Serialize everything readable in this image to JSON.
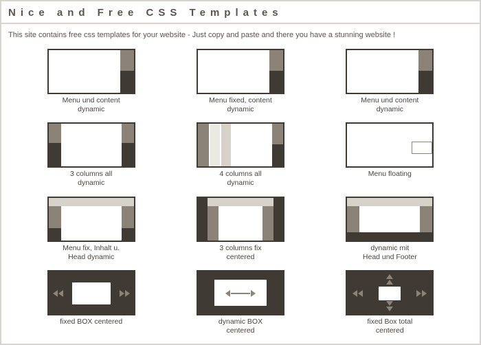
{
  "header": {
    "title": "Nice and Free CSS Templates",
    "subtitle": "This site contains free css templates for your website - Just copy and paste and there you have a stunning website !"
  },
  "templates": [
    {
      "caption": "Menu und content\ndynamic"
    },
    {
      "caption": "Menu fixed, content\ndynamic"
    },
    {
      "caption": "Menu und content\ndynamic"
    },
    {
      "caption": "3 columns all\ndynamic"
    },
    {
      "caption": "4 columns all\ndynamic"
    },
    {
      "caption": "Menu floating"
    },
    {
      "caption": "Menu fix, Inhalt u.\nHead dynamic"
    },
    {
      "caption": "3 columns fix\ncentered"
    },
    {
      "caption": "dynamic mit\nHead und Footer"
    },
    {
      "caption": "fixed BOX centered"
    },
    {
      "caption": "dynamic BOX\ncentered"
    },
    {
      "caption": "fixed Box total\ncentered"
    }
  ],
  "colors": {
    "frame": "#d8d4d0",
    "dark": "#403a34",
    "mid": "#8b8377",
    "light": "#d6d2ca",
    "pale": "#ece9e3"
  }
}
